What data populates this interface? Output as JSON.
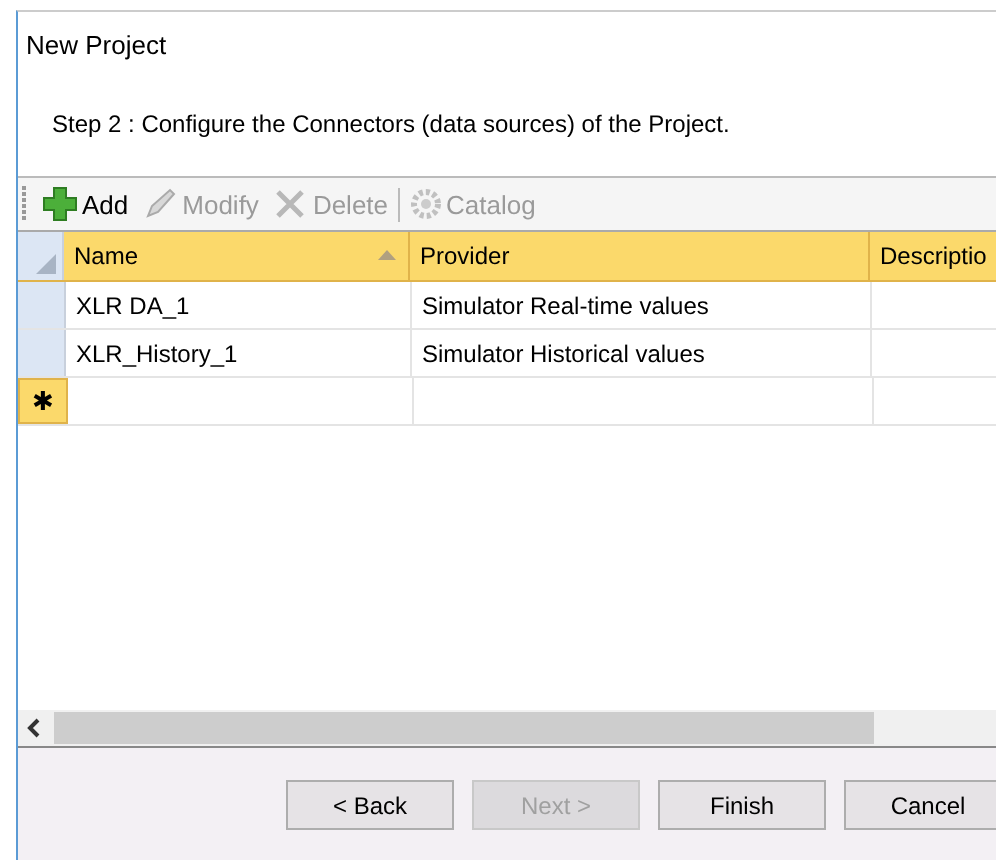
{
  "window": {
    "title": "New Project"
  },
  "step": "Step 2 : Configure the Connectors (data sources) of the Project.",
  "toolbar": [
    {
      "kind": "add",
      "label": "Add",
      "disabled": false
    },
    {
      "kind": "modify",
      "label": "Modify",
      "disabled": true
    },
    {
      "kind": "delete",
      "label": "Delete",
      "disabled": true
    },
    {
      "kind": "catalog",
      "label": "Catalog",
      "disabled": true
    }
  ],
  "table": {
    "columns": [
      {
        "label": "Name",
        "sorted": true
      },
      {
        "label": "Provider",
        "sorted": false
      },
      {
        "label": "Descriptio",
        "sorted": false
      }
    ],
    "rows": [
      [
        "XLR DA_1",
        "Simulator Real-time values"
      ],
      [
        "XLR_History_1",
        "Simulator Historical values"
      ]
    ],
    "new_row_marker": "✱"
  },
  "buttons": [
    {
      "label": "< Back",
      "disabled": false
    },
    {
      "label": "Next >",
      "disabled": true
    },
    {
      "label": "Finish",
      "disabled": false
    },
    {
      "label": "Cancel",
      "disabled": false
    }
  ]
}
